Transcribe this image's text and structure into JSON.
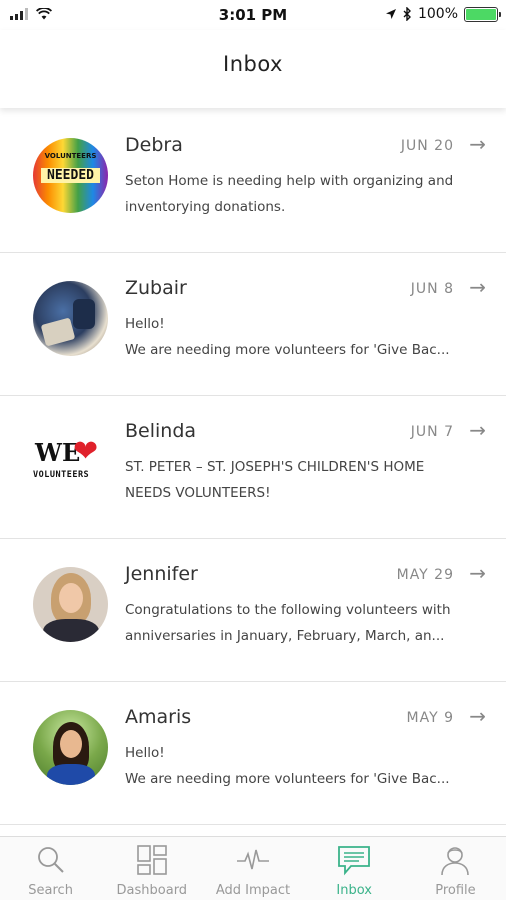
{
  "status_bar": {
    "time": "3:01 PM",
    "battery": "100%"
  },
  "header": {
    "title": "Inbox"
  },
  "messages": [
    {
      "name": "Debra",
      "date": "JUN 20",
      "line1": "Seton Home is needing help with organizing and",
      "line2": "inventorying donations.",
      "avatar_text_top": "VOLUNTEERS",
      "avatar_text_main": "NEEDED"
    },
    {
      "name": "Zubair",
      "date": "JUN 8",
      "line1": "Hello!",
      "line2": "We are needing more volunteers for 'Give Bac..."
    },
    {
      "name": "Belinda",
      "date": "JUN 7",
      "line1": "ST. PETER – ST. JOSEPH'S CHILDREN'S HOME",
      "line2": "NEEDS VOLUNTEERS!",
      "avatar_text_top": "WE",
      "avatar_text_main": "VOLUNTEERS"
    },
    {
      "name": "Jennifer",
      "date": "MAY 29",
      "line1": "Congratulations to the following volunteers with",
      "line2": "anniversaries in January, February, March, an..."
    },
    {
      "name": "Amaris",
      "date": "MAY 9",
      "line1": "Hello!",
      "line2": "We are needing more volunteers for 'Give Bac..."
    }
  ],
  "tabs": [
    {
      "label": "Search",
      "icon": "search-icon"
    },
    {
      "label": "Dashboard",
      "icon": "dashboard-icon"
    },
    {
      "label": "Add Impact",
      "icon": "pulse-icon"
    },
    {
      "label": "Inbox",
      "icon": "inbox-icon"
    },
    {
      "label": "Profile",
      "icon": "profile-icon"
    }
  ],
  "colors": {
    "accent": "#3bb38a",
    "battery": "#4cd964",
    "divider": "#e3e3e3",
    "muted": "#999999"
  }
}
